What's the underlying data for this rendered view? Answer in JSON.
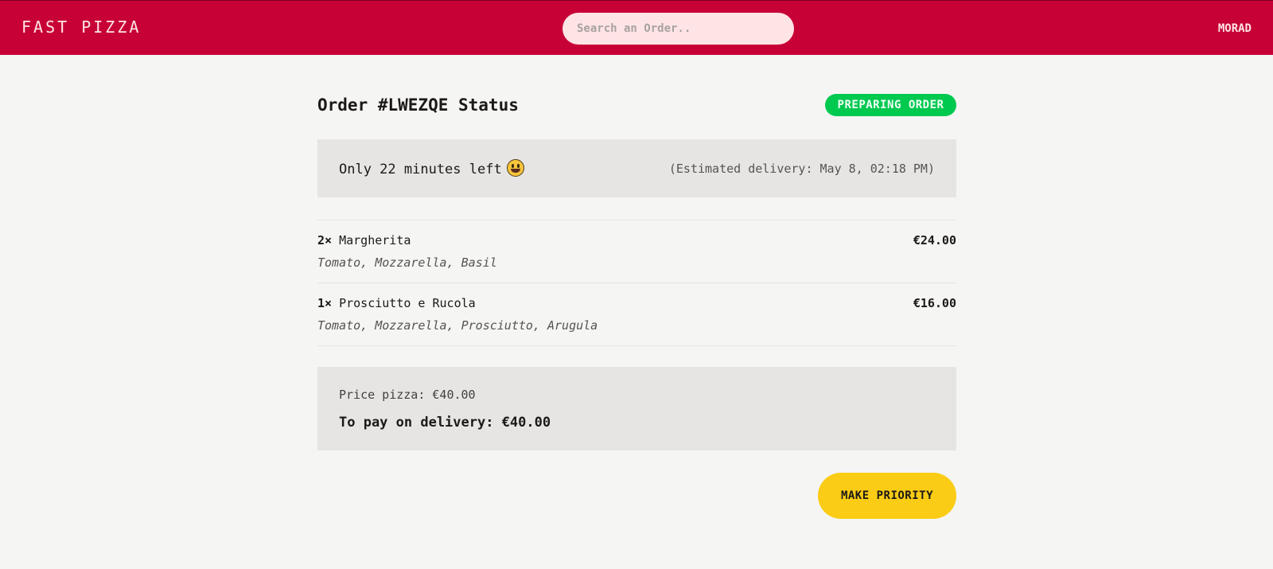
{
  "header": {
    "logo": "FAST PIZZA",
    "search_placeholder": "Search an Order..",
    "search_value": "",
    "username": "MORAD"
  },
  "order": {
    "title": "Order #LWEZQE Status",
    "status": "PREPARING ORDER",
    "time_left": "Only 22 minutes left",
    "emoji_icon": "grinning-face-emoji",
    "estimated_delivery": "(Estimated delivery: May 8, 02:18 PM)",
    "items": [
      {
        "quantity": "2×",
        "name": "Margherita",
        "price": "€24.00",
        "ingredients": "Tomato, Mozzarella, Basil"
      },
      {
        "quantity": "1×",
        "name": "Prosciutto e Rucola",
        "price": "€16.00",
        "ingredients": "Tomato, Mozzarella, Prosciutto, Arugula"
      }
    ],
    "price_pizza": "Price pizza: €40.00",
    "to_pay": "To pay on delivery: €40.00",
    "priority_button": "MAKE PRIORITY"
  },
  "colors": {
    "header_background": "#c70036",
    "page_background": "#f5f5f4",
    "status_badge": "#00c950",
    "priority_button": "#facc15",
    "panel_background": "#e7e5e4"
  }
}
